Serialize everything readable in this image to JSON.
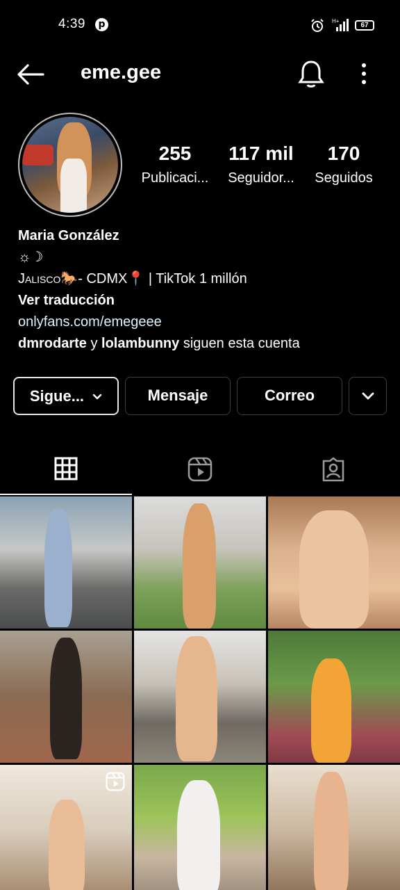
{
  "status_bar": {
    "time": "4:39",
    "notification_icon": "pinterest-icon",
    "alarm_icon": "alarm-icon",
    "network": "H+",
    "battery": "67"
  },
  "header": {
    "back_icon": "arrow-left-icon",
    "username": "eme.gee",
    "bell_icon": "bell-icon",
    "more_icon": "more-vertical-icon"
  },
  "profile": {
    "stats": [
      {
        "value": "255",
        "label": "Publicaci..."
      },
      {
        "value": "117 mil",
        "label": "Seguidor..."
      },
      {
        "value": "170",
        "label": "Seguidos"
      }
    ],
    "name": "Maria González",
    "emoji_line": "☼☽",
    "location_line_a": "Jalisco",
    "location_line_b": "🐎- CDMX📍 |  TikTok 1 millón",
    "translate": "Ver traducción",
    "link": "onlyfans.com/emegeee",
    "followed_by_a": "dmrodarte",
    "followed_by_mid": " y ",
    "followed_by_b": "lolambunny",
    "followed_by_tail": " siguen esta cuenta"
  },
  "actions": {
    "following": "Sigue...",
    "message": "Mensaje",
    "email": "Correo"
  },
  "tabs": [
    "grid-icon",
    "reels-icon",
    "tagged-icon"
  ],
  "colors": {
    "background": "#000000",
    "text": "#ffffff",
    "link": "#e0f1ff",
    "button_border": "#3c3c3c"
  }
}
